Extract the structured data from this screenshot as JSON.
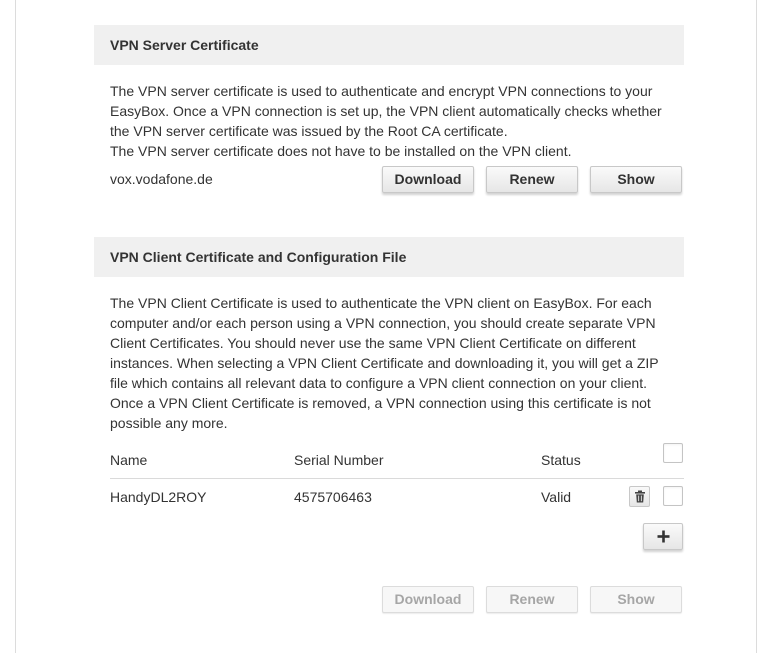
{
  "server_cert": {
    "title": "VPN Server Certificate",
    "description_lines": [
      "The VPN server certificate is used to authenticate and encrypt VPN connections to your",
      "EasyBox. Once a VPN connection is set up, the VPN client automatically checks whether",
      "the VPN server certificate was issued by the Root CA certificate.",
      "The VPN server certificate does not have to be installed on the VPN client."
    ],
    "hostname": "vox.vodafone.de",
    "buttons": {
      "download": "Download",
      "renew": "Renew",
      "show": "Show"
    }
  },
  "client_cert": {
    "title": "VPN Client Certificate and Configuration File",
    "description_lines": [
      "The VPN Client Certificate is used to authenticate the VPN client on EasyBox. For each",
      "computer and/or each person using a VPN connection, you should create separate VPN",
      "Client Certificates. You should never use the same VPN Client Certificate on different",
      "instances. When selecting a VPN Client Certificate and downloading it, you will get a ZIP",
      "file which contains all relevant data to configure a VPN client connection on your client.",
      "Once a VPN Client Certificate is removed, a VPN connection using this certificate is not",
      "possible any more."
    ],
    "table": {
      "columns": [
        "Name",
        "Serial Number",
        "Status"
      ],
      "rows": [
        {
          "name": "HandyDL2ROY",
          "serial": "4575706463",
          "status": "Valid"
        }
      ]
    },
    "icons": {
      "delete": "trash-icon",
      "add": "plus-icon"
    },
    "buttons": {
      "download": "Download",
      "renew": "Renew",
      "show": "Show"
    }
  }
}
